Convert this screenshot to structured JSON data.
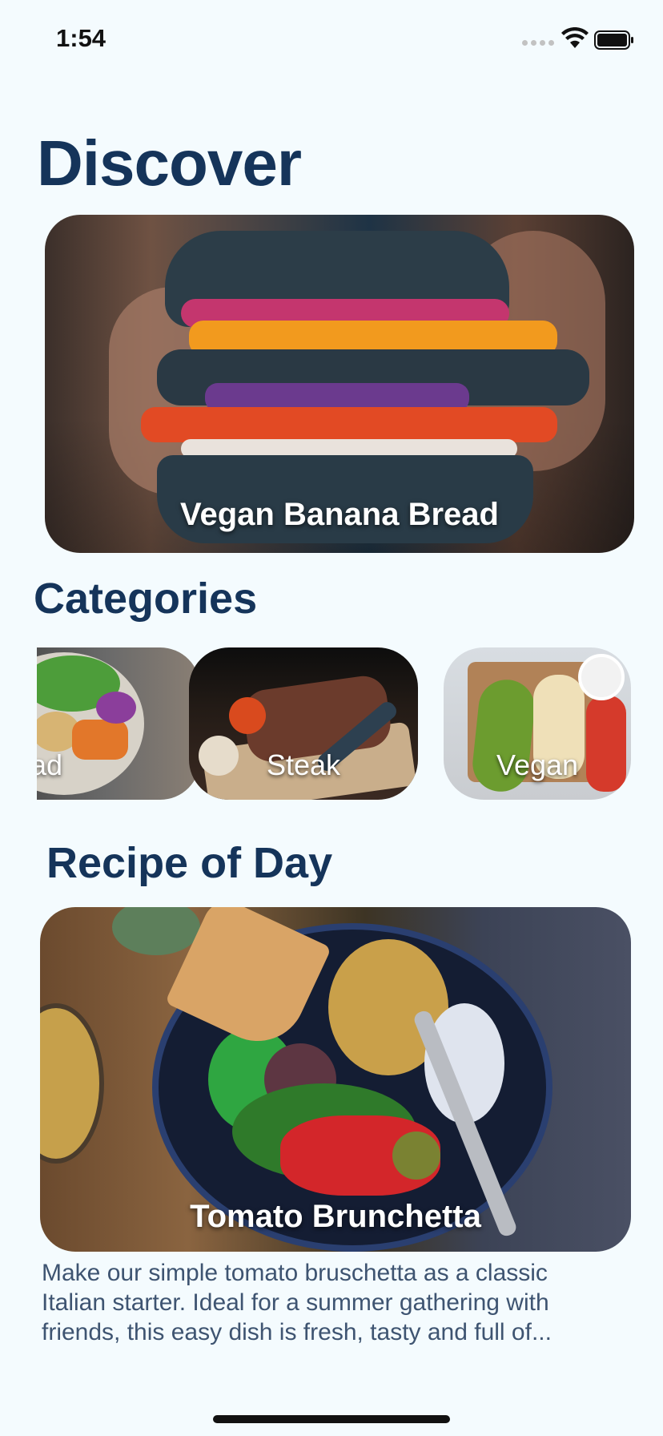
{
  "status_bar": {
    "time": "1:54"
  },
  "header": {
    "title": "Discover"
  },
  "featured": {
    "title": "Vegan Banana Bread"
  },
  "categories": {
    "heading": "Categories",
    "items": [
      {
        "label": "lad"
      },
      {
        "label": "Steak"
      },
      {
        "label": "Vegan"
      }
    ]
  },
  "recipe_of_day": {
    "heading": "Recipe of Day",
    "title": "Tomato Brunchetta",
    "description": "Make our simple tomato bruschetta as a classic Italian starter. Ideal for a summer gathering with friends, this easy dish is fresh, tasty and full of..."
  },
  "colors": {
    "background": "#f4fbfe",
    "heading": "#15345a",
    "body_text": "#3e5471"
  }
}
